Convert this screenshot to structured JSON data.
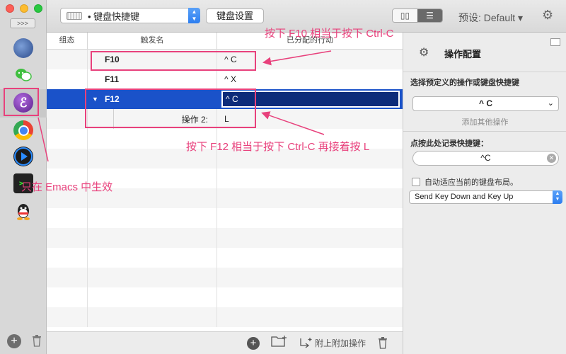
{
  "sidebar": {
    "expand_label": ">>>",
    "apps": [
      {
        "name": "globe",
        "glyph": ""
      },
      {
        "name": "wechat",
        "glyph": ""
      },
      {
        "name": "emacs",
        "glyph": "ℰ"
      },
      {
        "name": "chrome",
        "glyph": ""
      },
      {
        "name": "player",
        "glyph": "▶"
      },
      {
        "name": "terminal",
        "glyph": ">_"
      },
      {
        "name": "qq",
        "glyph": ""
      }
    ],
    "add_label": "+",
    "trash_label": "🗑"
  },
  "toolbar": {
    "select_value": "• 键盘快捷键",
    "settings_label": "键盘设置",
    "preset_label": "预设: Default ▾"
  },
  "table": {
    "headers": [
      "组态",
      "触发名",
      "已分配的行动"
    ],
    "rows": [
      {
        "trigger": "F10",
        "action": "^ C"
      },
      {
        "trigger": "F11",
        "action": "^ X"
      },
      {
        "trigger": "F12",
        "action": "^ C"
      },
      {
        "trigger": "操作 2:",
        "action": "L"
      }
    ]
  },
  "bottom_bar": {
    "attach_label": "附上附加操作"
  },
  "right_panel": {
    "title": "操作配置",
    "predefined_label": "选择预定义的操作或键盘快捷键",
    "predefined_value": "^ C",
    "add_other": "添加其他操作",
    "record_label": "点按此处记录快捷键：",
    "record_value": "^C",
    "auto_adapt_label": "自动适应当前的键盘布局。",
    "send_mode": "Send Key Down and Key Up"
  },
  "annotations": {
    "f10_note": "按下 F10 相当于按下 Ctrl-C",
    "f12_note": "按下 F12 相当于按下 Ctrl-C 再接着按 L",
    "emacs_note": "只在 Emacs 中生效"
  },
  "colors": {
    "annotation": "#e8417c",
    "selection": "#1a52c9"
  }
}
